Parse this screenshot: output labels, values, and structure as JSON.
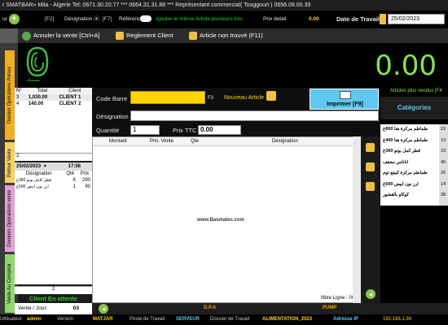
{
  "titlebar": {
    "text": "r SMATBAR»   Mila - Algerie Tel: 0671.30.20.77  *** 0664.31.31.88  ***  Représentant commercial( Touggourt )  0656.09.00.39"
  },
  "options": {
    "user_prefix": "ur",
    "f2": "[F2]",
    "designation": "Désignation",
    "f7": "[F7]",
    "reference": "Référence",
    "ajouter_label": "Ajouter le même Article plusieurs fois",
    "prix_detail": "Prix detail",
    "prix_detail_value": "0.00",
    "date_label": "Date de Travail",
    "date_value": "25/02/2023"
  },
  "actions": {
    "annuler": "Annuler la vente [Ctrl+A]",
    "reglement": "Reglement Client",
    "non_trouve": "Article non trouvé (F11)"
  },
  "total": "0.00",
  "logo_text": "بصمتك",
  "vtabs": [
    "Dernier Opérations Retour",
    "Retour Vente",
    "Derniers Opérations  vente",
    "Vente Au Comptoir"
  ],
  "clients": {
    "headers": [
      "N°",
      "Total",
      "Client"
    ],
    "rows": [
      {
        "n": "3",
        "total": "1,030.00",
        "client": "CLIENT 1"
      },
      {
        "n": "4",
        "total": "140.00",
        "client": "CLIENT 2"
      }
    ],
    "count": "2"
  },
  "history": {
    "date": "25/02/2023",
    "time": "17:56",
    "headers": [
      "Désignation",
      "Qté",
      "Prix"
    ],
    "rows": [
      {
        "designation": "قطر كامل بوتو 360غ",
        "qte": "6",
        "prix": "290"
      },
      {
        "designation": "ارز نون ابيض 500غ",
        "qte": "1",
        "prix": "90"
      }
    ],
    "count": "2"
  },
  "client_en_attente": "Client En attente",
  "vente_jour_label": "Vente / Jour:",
  "vente_jour_value": "03",
  "form": {
    "code_barre": "Code Barre",
    "f3": "F3",
    "nouveau_article": "Nouveau Article",
    "imprimer": "Imprimer [F9]",
    "designation": "Désignation",
    "quantite": "Quantité",
    "quantite_value": "1",
    "prix_ttc": "Prix TTC",
    "prix_ttc_value": "0.00"
  },
  "items_table": {
    "headers": [
      "Montant",
      "Prix. Vente",
      "Qte",
      "Désignation"
    ],
    "watermark": "www.Basmatec.com",
    "nbre_ligne_label": "Nbre Ligne :",
    "nbre_ligne_value": "00"
  },
  "right": {
    "plus_vendus": "Articles plus vendus  [F4",
    "categories": "Catégories",
    "items": [
      {
        "name": "طماطم مركزة هنا 800غ",
        "num": "22"
      },
      {
        "name": "طماطم مركزة هنا 400غ",
        "num": "13"
      },
      {
        "name": "قطر كمل بوتو 360غ",
        "num": "19"
      },
      {
        "name": "اناناس مجفف",
        "num": "40"
      },
      {
        "name": "طماطم مركزة كيبتع توم",
        "num": "26"
      },
      {
        "name": "ارز نون ابيض 500غ",
        "num": "14"
      },
      {
        "name": "كوكاو بالقشور",
        "num": "38"
      }
    ]
  },
  "navbar": {
    "dpa": "D.P.A",
    "pump": "PUMP"
  },
  "status": {
    "user_label": "Utilisateur",
    "user": "admin",
    "version_label": "Version",
    "version": "MATJAR",
    "poste_label": "Poste de Travail",
    "poste": "SERVEUR",
    "dossier_label": "Dossier de Travail",
    "dossier": "ALIMENTATION_2023",
    "ip_label": "Adresse IP",
    "ip": "192.168.1.36"
  }
}
